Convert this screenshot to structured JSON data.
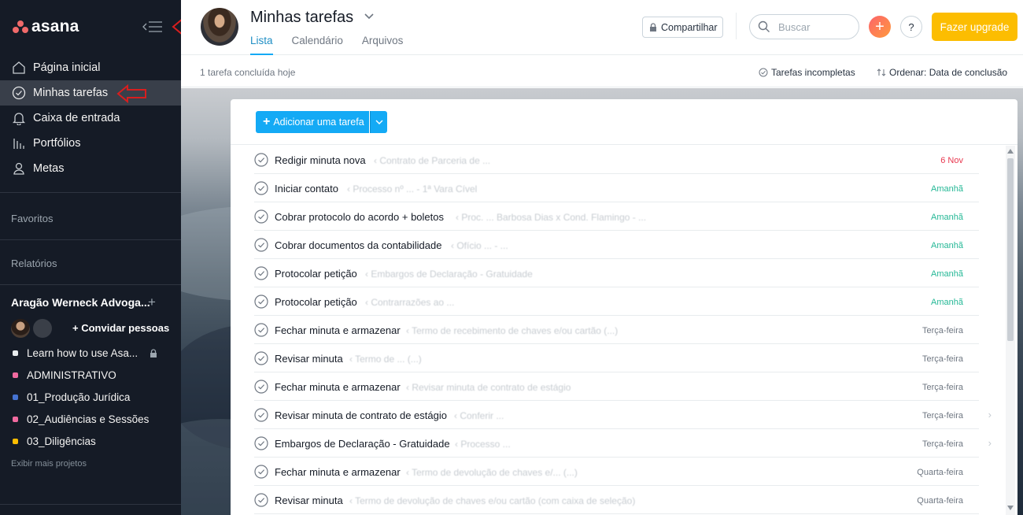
{
  "app": {
    "brand": "asana",
    "accent": "#14aaf5",
    "brand_color": "#f06a6a"
  },
  "sidebar": {
    "nav": [
      {
        "label": "Página inicial",
        "icon": "home-icon"
      },
      {
        "label": "Minhas tarefas",
        "icon": "check-circle-icon",
        "active": true
      },
      {
        "label": "Caixa de entrada",
        "icon": "bell-icon"
      },
      {
        "label": "Portfólios",
        "icon": "bar-chart-icon"
      },
      {
        "label": "Metas",
        "icon": "person-icon"
      }
    ],
    "favorites_label": "Favoritos",
    "reports_label": "Relatórios",
    "team_name": "Aragão Werneck Advoga...",
    "team_plus": "+",
    "invite_label": "Convidar pessoas",
    "projects": [
      {
        "label": "Learn how to use Asa...",
        "color": "#e8ecee",
        "locked": true
      },
      {
        "label": "ADMINISTRATIVO",
        "color": "#f06a9f"
      },
      {
        "label": "01_Produção Jurídica",
        "color": "#4573d2"
      },
      {
        "label": "02_Audiências e Sessões",
        "color": "#f06a9f"
      },
      {
        "label": "03_Diligências",
        "color": "#fcbd01"
      }
    ],
    "more_projects": "Exibir mais projetos"
  },
  "header": {
    "title": "Minhas tarefas",
    "tabs": [
      "Lista",
      "Calendário",
      "Arquivos"
    ],
    "share_label": "Compartilhar",
    "search_placeholder": "Buscar",
    "plus_label": "+",
    "help_label": "?",
    "upgrade_label": "Fazer upgrade"
  },
  "subheader": {
    "done_today": "1 tarefa concluída hoje",
    "filter_label": "Tarefas incompletas",
    "sort_label": "Ordenar: Data de conclusão"
  },
  "main": {
    "add_task_label": "Adicionar uma tarefa",
    "tasks": [
      {
        "name": "Redigir minuta nova",
        "project": "‹ Contrato de Parceria de ...",
        "due": "6 Nov",
        "due_color": "#e8384f"
      },
      {
        "name": "Iniciar contato",
        "project": "‹ Processo nº ... - 1ª Vara Cível",
        "due": "Amanhã",
        "due_color": "#25b896"
      },
      {
        "name": "Cobrar protocolo do acordo + boletos",
        "project": "‹ Proc. ... Barbosa Dias x Cond. Flamingo - ...",
        "due": "Amanhã",
        "due_color": "#25b896"
      },
      {
        "name": "Cobrar documentos da contabilidade",
        "project": "‹ Ofício ... - ... ",
        "due": "Amanhã",
        "due_color": "#25b896"
      },
      {
        "name": "Protocolar petição",
        "project": "‹ Embargos de Declaração - Gratuidade",
        "due": "Amanhã",
        "due_color": "#25b896"
      },
      {
        "name": "Protocolar petição",
        "project": "‹ Contrarrazões ao ... ",
        "due": "Amanhã",
        "due_color": "#25b896"
      },
      {
        "name": "Fechar minuta e armazenar",
        "project": "‹ Termo de recebimento de chaves e/ou cartão (...)",
        "due": "Terça-feira",
        "due_color": "#6f7782"
      },
      {
        "name": "Revisar minuta",
        "project": "‹ Termo de ... (...)",
        "due": "Terça-feira",
        "due_color": "#6f7782"
      },
      {
        "name": "Fechar minuta e armazenar",
        "project": "‹ Revisar minuta de contrato de estágio",
        "due": "Terça-feira",
        "due_color": "#6f7782"
      },
      {
        "name": "Revisar minuta de contrato de estágio",
        "project": "‹ Conferir ... ",
        "due": "Terça-feira",
        "due_color": "#6f7782",
        "arrow": true
      },
      {
        "name": "Embargos de Declaração - Gratuidade",
        "project": "‹ Processo ... ",
        "due": "Terça-feira",
        "due_color": "#6f7782",
        "arrow": true
      },
      {
        "name": "Fechar minuta e armazenar",
        "project": "‹ Termo de devolução de chaves e/... (...)",
        "due": "Quarta-feira",
        "due_color": "#6f7782"
      },
      {
        "name": "Revisar minuta",
        "project": "‹ Termo de devolução de chaves e/ou cartão (com caixa de seleção)",
        "due": "Quarta-feira",
        "due_color": "#6f7782"
      }
    ]
  }
}
